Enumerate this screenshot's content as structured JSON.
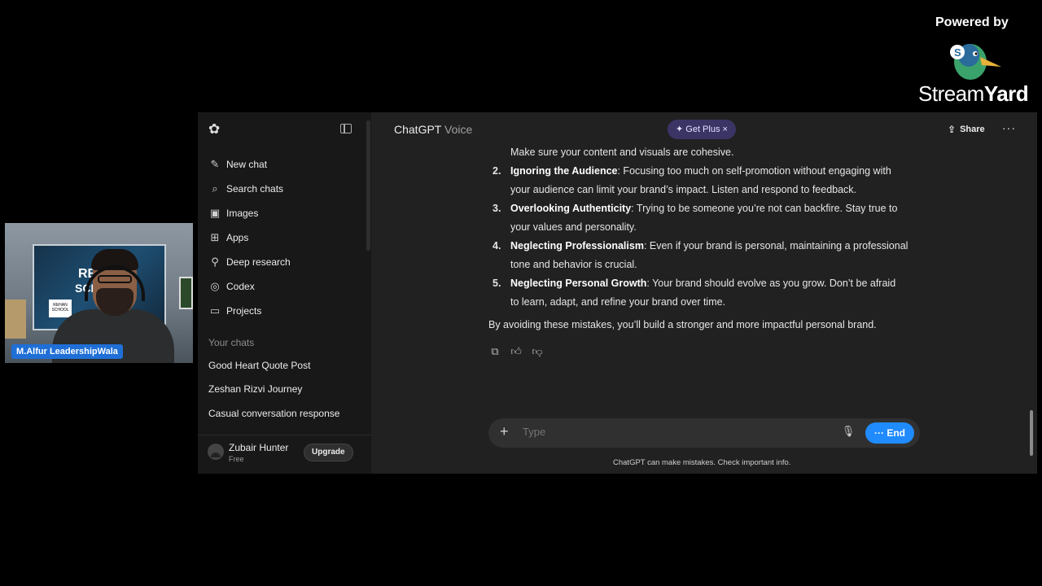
{
  "branding": {
    "powered_by": "Powered by",
    "brand_a": "Stream",
    "brand_b": "Yard"
  },
  "webcam": {
    "name": "M.Alfur LeadershipWala",
    "board_line1": "REI",
    "board_line2": "SCH",
    "board_label": "REHAN SCHOOL"
  },
  "sidebar": {
    "items": [
      {
        "label": "New chat",
        "icon": "edit-icon"
      },
      {
        "label": "Search chats",
        "icon": "search-icon"
      },
      {
        "label": "Images",
        "icon": "image-icon"
      },
      {
        "label": "Apps",
        "icon": "grid-icon"
      },
      {
        "label": "Deep research",
        "icon": "telescope-icon"
      },
      {
        "label": "Codex",
        "icon": "codex-icon"
      },
      {
        "label": "Projects",
        "icon": "folder-icon"
      }
    ],
    "section_label": "Your chats",
    "chats": [
      "Good Heart Quote Post",
      "Zeshan Rizvi Journey",
      "Casual conversation response"
    ],
    "user": {
      "name": "Zubair Hunter",
      "plan": "Free",
      "upgrade": "Upgrade"
    }
  },
  "header": {
    "title": "ChatGPT",
    "title_mode": "Voice",
    "get_plus": "✦ Get Plus ×",
    "share": "Share"
  },
  "message": {
    "lead": "Make sure your content and visuals are cohesive.",
    "items": [
      {
        "num": "2.",
        "title": "Ignoring the Audience",
        "text": ": Focusing too much on self-promotion without engaging with",
        "cont": "your audience can limit your brand’s impact. Listen and respond to feedback."
      },
      {
        "num": "3.",
        "title": "Overlooking Authenticity",
        "text": ": Trying to be someone you’re not can backfire. Stay true to",
        "cont": "your values and personality."
      },
      {
        "num": "4.",
        "title": "Neglecting Professionalism",
        "text": ": Even if your brand is personal, maintaining a professional",
        "cont": "tone and behavior is crucial."
      },
      {
        "num": "5.",
        "title": "Neglecting Personal Growth",
        "text": ": Your brand should evolve as you grow. Don’t be afraid",
        "cont": "to learn, adapt, and refine your brand over time."
      }
    ],
    "summary": "By avoiding these mistakes, you’ll build a stronger and more impactful personal brand."
  },
  "composer": {
    "placeholder": "Type",
    "end_label": "End"
  },
  "disclaimer": "ChatGPT can make mistakes. Check important info."
}
